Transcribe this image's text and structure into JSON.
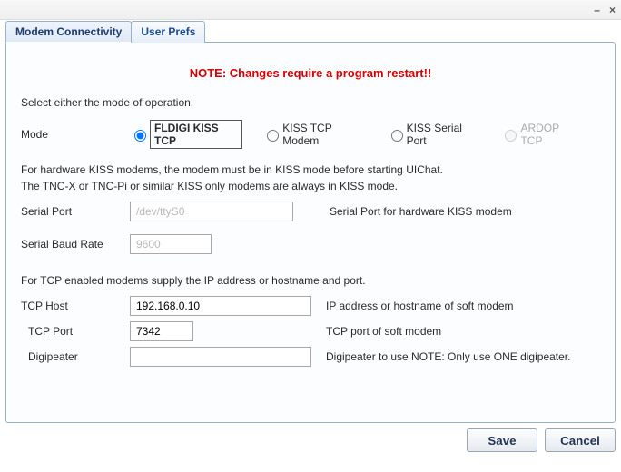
{
  "tabs": {
    "modem": "Modem Connectivity",
    "prefs": "User Prefs"
  },
  "note": "NOTE: Changes require a program restart!!",
  "instr1": "Select either the mode of operation.",
  "modeLabel": "Mode",
  "modes": {
    "opt1": "FLDIGI KISS TCP",
    "opt2": "KISS TCP Modem",
    "opt3": "KISS Serial Port",
    "opt4": "ARDOP TCP"
  },
  "para1a": "For hardware KISS modems, the modem must be in KISS mode before starting UIChat.",
  "para1b": "The TNC-X or TNC-Pi or similar KISS only modems are always in KISS mode.",
  "serialPort": {
    "label": "Serial Port",
    "value": "/dev/ttyS0",
    "hint": "Serial Port for hardware KISS modem"
  },
  "serialBaud": {
    "label": "Serial Baud Rate",
    "value": "9600"
  },
  "para2": "For TCP enabled modems supply the IP address or hostname and port.",
  "tcpHost": {
    "label": "TCP Host",
    "value": "192.168.0.10",
    "hint": "IP address or hostname of soft modem"
  },
  "tcpPort": {
    "label": "TCP Port",
    "value": "7342",
    "hint": "TCP port of soft modem"
  },
  "digipeater": {
    "label": "Digipeater",
    "value": "",
    "hint": "Digipeater to use NOTE: Only use ONE digipeater."
  },
  "buttons": {
    "save": "Save",
    "cancel": "Cancel"
  }
}
